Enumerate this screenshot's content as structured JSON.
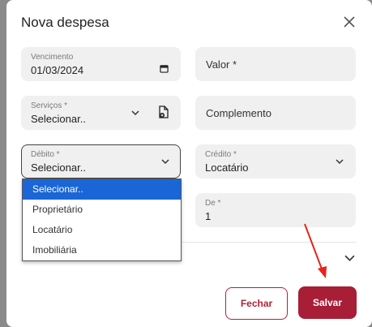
{
  "modal": {
    "title": "Nova despesa"
  },
  "fields": {
    "vencimento": {
      "label": "Vencimento",
      "value": "01/03/2024"
    },
    "valor": {
      "placeholder": "Valor *"
    },
    "servicos": {
      "label": "Serviços *",
      "value": "Selecionar.."
    },
    "complemento": {
      "placeholder": "Complemento"
    },
    "debito": {
      "label": "Débito *",
      "value": "Selecionar.."
    },
    "credito": {
      "label": "Crédito *",
      "value": "Locatário"
    },
    "de": {
      "label": "De *",
      "value": "1"
    }
  },
  "debito_options": [
    "Selecionar..",
    "Proprietário",
    "Locatário",
    "Imobiliária"
  ],
  "buttons": {
    "fechar": "Fechar",
    "salvar": "Salvar"
  },
  "colors": {
    "accent": "#a81e37",
    "selected_option": "#1a66d6",
    "annotation_arrow": "#e8221b"
  },
  "icons": [
    "close-icon",
    "calendar-icon",
    "chevron-down-icon",
    "add-document-icon"
  ]
}
